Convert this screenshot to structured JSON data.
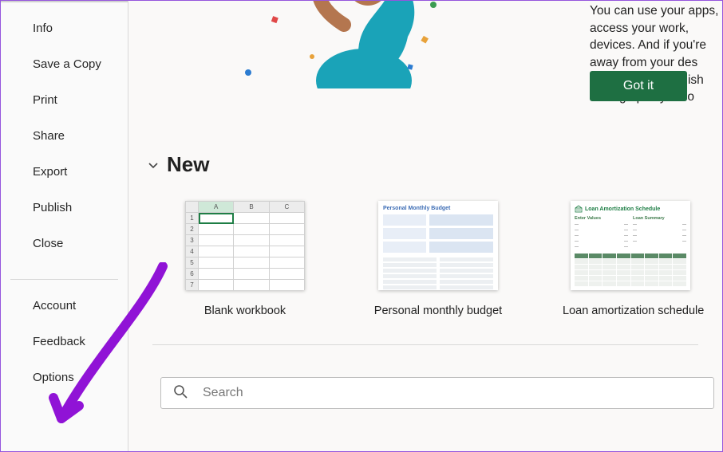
{
  "sidebar": {
    "items": [
      {
        "label": "Info"
      },
      {
        "label": "Save a Copy"
      },
      {
        "label": "Print"
      },
      {
        "label": "Share"
      },
      {
        "label": "Export"
      },
      {
        "label": "Publish"
      },
      {
        "label": "Close"
      }
    ],
    "bottom_items": [
      {
        "label": "Account"
      },
      {
        "label": "Feedback"
      },
      {
        "label": "Options"
      }
    ]
  },
  "hero": {
    "text": "You can use your apps, access your work, devices. And if you're away from your des your phone. To finish setting up in your o",
    "got_it_label": "Got it"
  },
  "new_section": {
    "title": "New",
    "templates": [
      {
        "label": "Blank workbook",
        "columns": [
          "A",
          "B",
          "C"
        ],
        "rows": [
          "1",
          "2",
          "3",
          "4",
          "5",
          "6",
          "7"
        ]
      },
      {
        "label": "Personal monthly budget",
        "thumb_title": "Personal Monthly Budget"
      },
      {
        "label": "Loan amortization schedule",
        "thumb_title": "Loan Amortization Schedule",
        "left_label": "Enter Values",
        "right_label": "Loan Summary"
      }
    ]
  },
  "search": {
    "placeholder": "Search"
  },
  "colors": {
    "accent": "#1e6f42",
    "arrow": "#9013d6"
  }
}
